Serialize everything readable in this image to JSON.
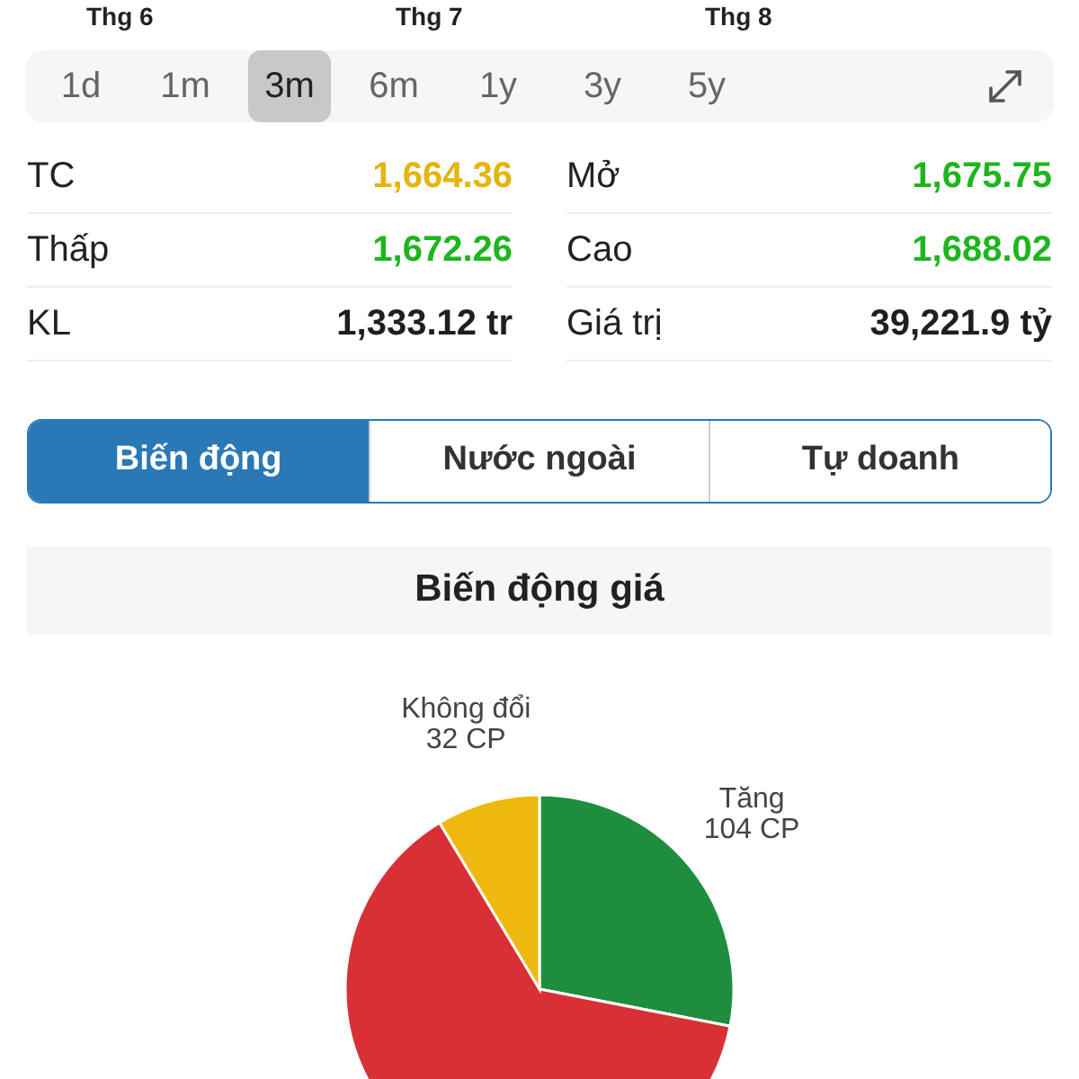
{
  "months": [
    "Thg 6",
    "Thg 7",
    "Thg 8"
  ],
  "ranges": [
    {
      "label": "1d",
      "selected": false
    },
    {
      "label": "1m",
      "selected": false
    },
    {
      "label": "3m",
      "selected": true
    },
    {
      "label": "6m",
      "selected": false
    },
    {
      "label": "1y",
      "selected": false
    },
    {
      "label": "3y",
      "selected": false
    },
    {
      "label": "5y",
      "selected": false
    }
  ],
  "stats": [
    {
      "label": "TC",
      "value": "1,664.36",
      "color": "#e5b40e"
    },
    {
      "label": "Mở",
      "value": "1,675.75",
      "color": "#1fb51f"
    },
    {
      "label": "Thấp",
      "value": "1,672.26",
      "color": "#1fb51f"
    },
    {
      "label": "Cao",
      "value": "1,688.02",
      "color": "#1fb51f"
    },
    {
      "label": "KL",
      "value": "1,333.12 tr",
      "color": "#1f1f1f"
    },
    {
      "label": "Giá trị",
      "value": "39,221.9 tỷ",
      "color": "#1f1f1f"
    }
  ],
  "tabs": [
    {
      "label": "Biến động",
      "selected": true
    },
    {
      "label": "Nước ngoài",
      "selected": false
    },
    {
      "label": "Tự doanh",
      "selected": false
    }
  ],
  "section_title": "Biến động giá",
  "pie_labels": [
    {
      "name": "Tăng",
      "count": "104 CP"
    },
    {
      "name": "Không đổi",
      "count": "32 CP"
    }
  ]
}
